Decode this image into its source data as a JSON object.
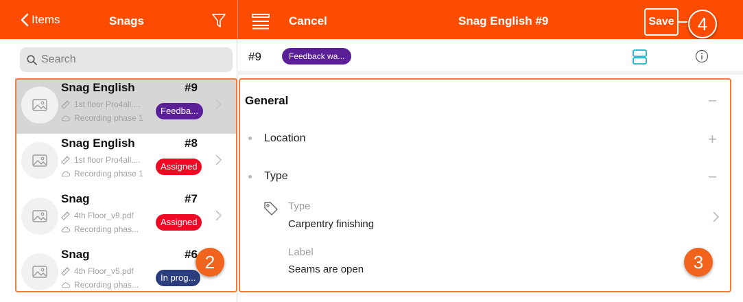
{
  "colors": {
    "accent": "#fc4c02",
    "feedback": "#5a1e96",
    "assigned": "#ee0a24",
    "in_progress": "#2c3d7e",
    "highlight": "#f07d3c"
  },
  "topbar": {
    "back_label": "Items",
    "list_title": "Snags",
    "cancel_label": "Cancel",
    "detail_title": "Snag English #9",
    "save_label": "Save",
    "icons": [
      "chevron-left-icon",
      "filter-icon",
      "menu-icon"
    ]
  },
  "search": {
    "placeholder": "Search"
  },
  "snags": [
    {
      "title": "Snag English",
      "number": "#9",
      "location": "1st floor Pro4all....",
      "phase": "Recording phase 1",
      "status": "Feedba...",
      "status_color": "#5a1e96",
      "selected": true
    },
    {
      "title": "Snag English",
      "number": "#8",
      "location": "1st floor Pro4all....",
      "phase": "Recording phase 1",
      "status": "Assigned",
      "status_color": "#ee0a24",
      "selected": false
    },
    {
      "title": "Snag",
      "number": "#7",
      "location": "4th Floor_v9.pdf",
      "phase": "Recording phas...",
      "status": "Assigned",
      "status_color": "#ee0a24",
      "selected": false
    },
    {
      "title": "Snag",
      "number": "#6",
      "location": "4th Floor_v5.pdf",
      "phase": "Recording phas...",
      "status": "In prog...",
      "status_color": "#2c3d7e",
      "selected": false
    }
  ],
  "detail": {
    "number": "#9",
    "status_badge": "Feedback wa...",
    "section_general": "General",
    "location_label": "Location",
    "type_label": "Type",
    "fields": [
      {
        "caption": "Type",
        "value": "Carpentry finishing"
      },
      {
        "caption": "Label",
        "value": "Seams are open"
      }
    ]
  },
  "steps": {
    "list": "2",
    "details": "3",
    "save": "4"
  }
}
